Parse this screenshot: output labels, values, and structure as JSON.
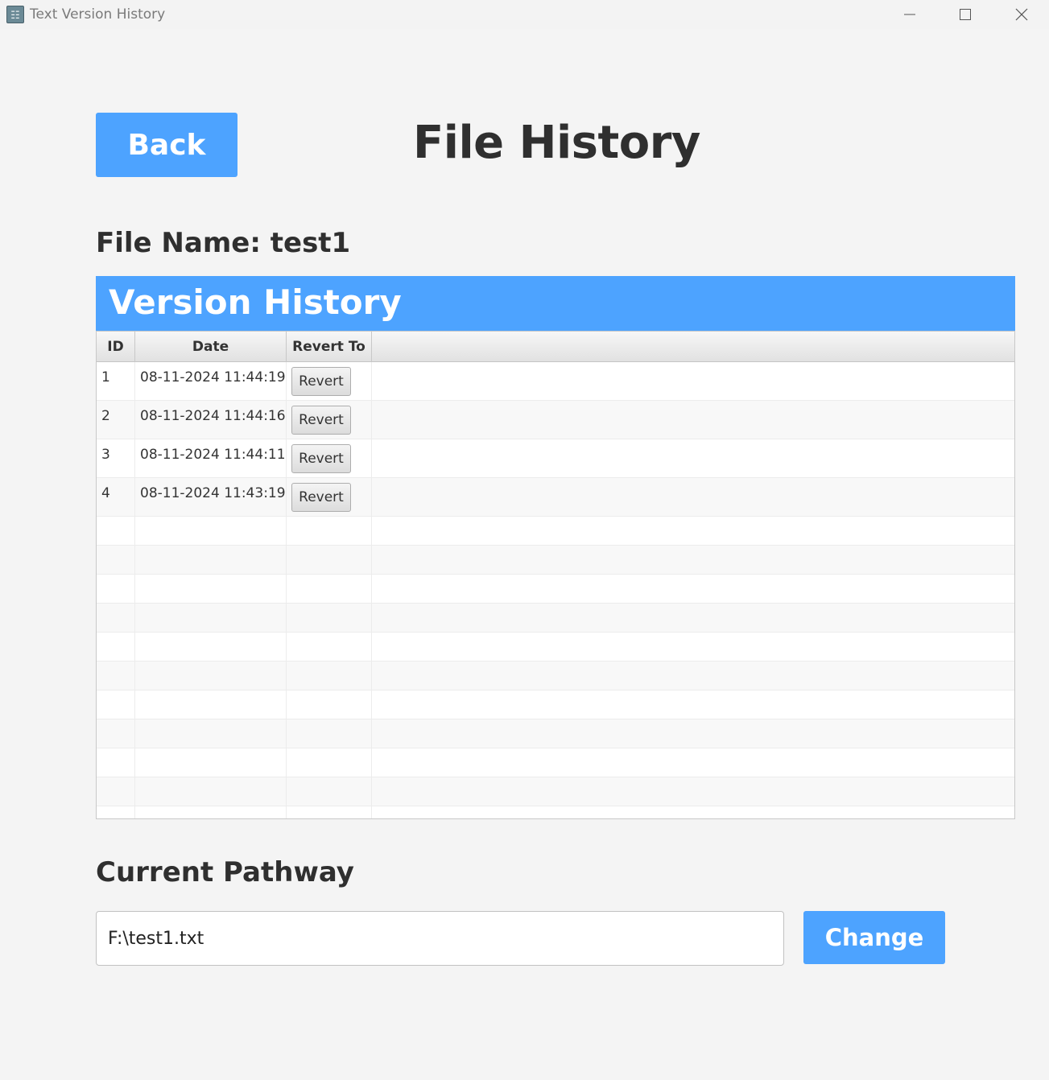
{
  "window": {
    "title": "Text Version History",
    "controls": [
      "minimize-icon",
      "maximize-icon",
      "close-icon"
    ]
  },
  "header": {
    "back_label": "Back",
    "title": "File History"
  },
  "file": {
    "name_label": "File Name: test1"
  },
  "version_history": {
    "title": "Version History",
    "columns": [
      "ID",
      "Date",
      "Revert To"
    ],
    "rows": [
      {
        "id": "1",
        "date": "08-11-2024 11:44:19",
        "action": "Revert"
      },
      {
        "id": "2",
        "date": "08-11-2024 11:44:16",
        "action": "Revert"
      },
      {
        "id": "3",
        "date": "08-11-2024 11:44:11",
        "action": "Revert"
      },
      {
        "id": "4",
        "date": "08-11-2024 11:43:19",
        "action": "Revert"
      }
    ]
  },
  "pathway": {
    "label": "Current Pathway",
    "value": "F:\\test1.txt",
    "change_label": "Change"
  },
  "colors": {
    "accent": "#4da3ff",
    "background": "#f4f4f4",
    "text": "#2f2f2f"
  }
}
